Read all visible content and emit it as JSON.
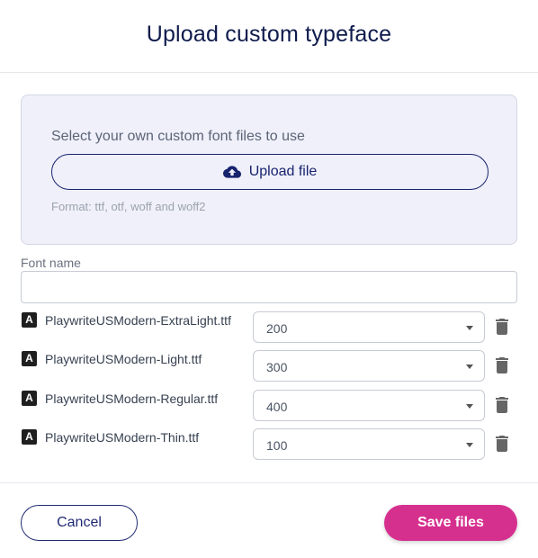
{
  "dialog": {
    "title": "Upload custom typeface"
  },
  "upload": {
    "hint": "Select your own custom font files to use",
    "button_label": "Upload file",
    "button_icon": "cloud-upload-icon",
    "format_note": "Format: ttf, otf, woff and woff2"
  },
  "font_name": {
    "label": "Font name",
    "value": "",
    "placeholder": ""
  },
  "files": [
    {
      "name": "PlaywriteUSModern-ExtraLight.ttf",
      "weight": "200",
      "file_icon": "font-file-icon",
      "delete_icon": "trash-icon"
    },
    {
      "name": "PlaywriteUSModern-Light.ttf",
      "weight": "300",
      "file_icon": "font-file-icon",
      "delete_icon": "trash-icon"
    },
    {
      "name": "PlaywriteUSModern-Regular.ttf",
      "weight": "400",
      "file_icon": "font-file-icon",
      "delete_icon": "trash-icon"
    },
    {
      "name": "PlaywriteUSModern-Thin.ttf",
      "weight": "100",
      "file_icon": "font-file-icon",
      "delete_icon": "trash-icon"
    }
  ],
  "footer": {
    "cancel_label": "Cancel",
    "save_label": "Save files"
  },
  "colors": {
    "title": "#0f1b4c",
    "accent_navy": "#18236e",
    "drop_zone_bg": "#eff0f9",
    "save_button": "#d6308f"
  }
}
